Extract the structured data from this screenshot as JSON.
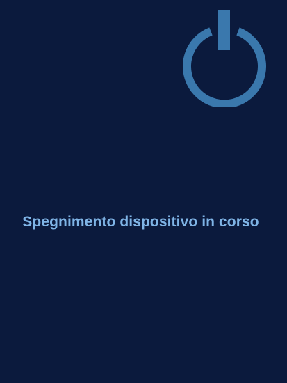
{
  "screen": {
    "status_message": "Spegnimento dispositivo in corso"
  },
  "icons": {
    "power": "power-icon"
  },
  "colors": {
    "background": "#0b1a3d",
    "accent": "#3a78ad",
    "text": "#7fb4e6"
  }
}
